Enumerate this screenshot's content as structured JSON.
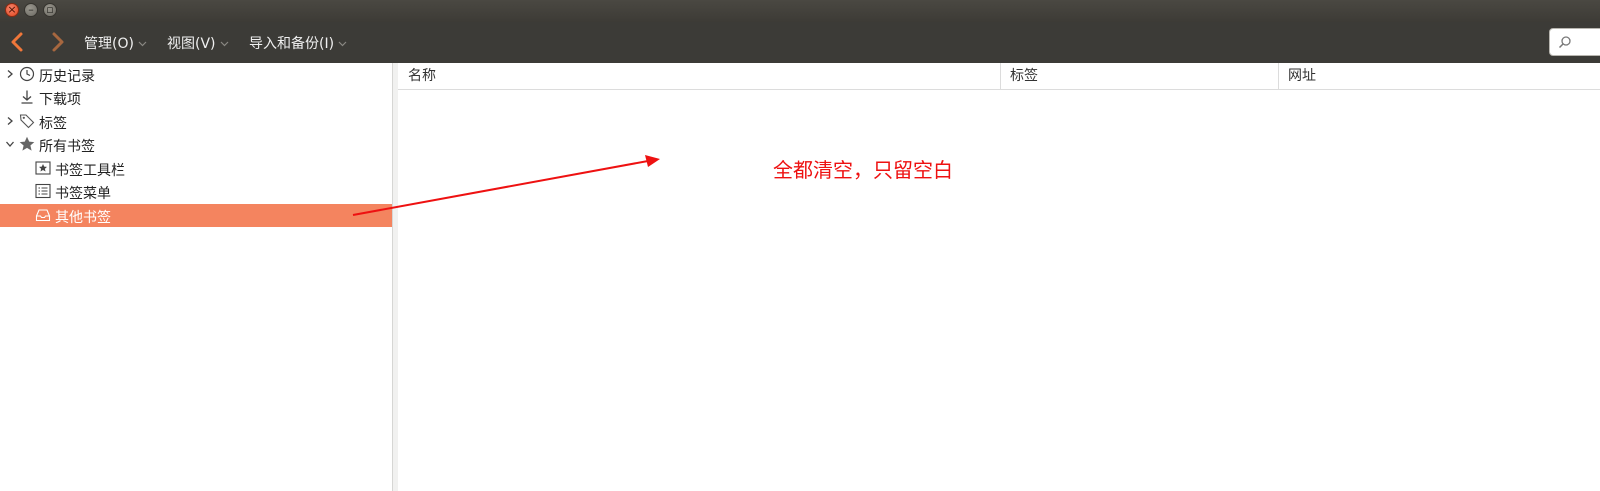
{
  "window": {
    "controls": [
      "close-icon",
      "minimize-icon",
      "maximize-icon"
    ]
  },
  "toolbar": {
    "back_icon": "chevron-left-icon",
    "forward_icon": "chevron-right-icon",
    "menus": [
      {
        "label": "管理(O)",
        "icon": "chevron-down-icon"
      },
      {
        "label": "视图(V)",
        "icon": "chevron-down-icon"
      },
      {
        "label": "导入和备份(I)",
        "icon": "chevron-down-icon"
      }
    ],
    "search_icon": "search-icon"
  },
  "sidebar": {
    "items": [
      {
        "label": "历史记录",
        "icon": "clock-icon",
        "expandable": true,
        "expanded": false
      },
      {
        "label": "下载项",
        "icon": "download-icon",
        "expandable": false
      },
      {
        "label": "标签",
        "icon": "tag-icon",
        "expandable": true,
        "expanded": false
      },
      {
        "label": "所有书签",
        "icon": "star-icon",
        "expandable": true,
        "expanded": true
      },
      {
        "label": "书签工具栏",
        "icon": "bookmark-toolbar-icon",
        "level": 1
      },
      {
        "label": "书签菜单",
        "icon": "bookmark-menu-icon",
        "level": 1
      },
      {
        "label": "其他书签",
        "icon": "unsorted-bookmarks-icon",
        "level": 1,
        "selected": true
      }
    ],
    "selected_color": "#f4845f"
  },
  "content": {
    "columns": [
      "名称",
      "标签",
      "网址"
    ]
  },
  "annotation": {
    "text": "全都清空，只留空白",
    "color": "#ee1111"
  }
}
